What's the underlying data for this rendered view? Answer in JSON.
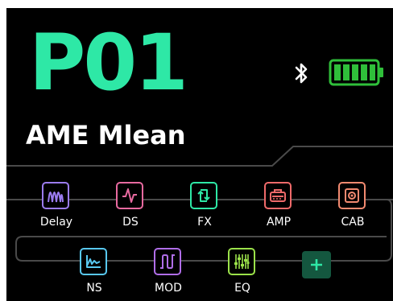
{
  "preset": {
    "number": "P01",
    "name": "AME Mlean"
  },
  "status": {
    "bluetooth_icon": "bluetooth-icon",
    "battery_icon": "battery-icon",
    "battery_level": 1.0,
    "battery_color": "#2fbf3a"
  },
  "chain_row_1": [
    {
      "label": "Delay",
      "icon": "delay-wave-icon",
      "color": "#9b7cf0"
    },
    {
      "label": "DS",
      "icon": "distortion-icon",
      "color": "#e86aa0"
    },
    {
      "label": "FX",
      "icon": "loop-arrows-icon",
      "color": "#2ee8a6"
    },
    {
      "label": "AMP",
      "icon": "amp-icon",
      "color": "#ef6a6a"
    },
    {
      "label": "CAB",
      "icon": "cabinet-icon",
      "color": "#f28a70"
    }
  ],
  "chain_row_2": [
    {
      "label": "NS",
      "icon": "noise-gate-icon",
      "color": "#58c8f0"
    },
    {
      "label": "MOD",
      "icon": "modulation-icon",
      "color": "#b06ee8"
    },
    {
      "label": "EQ",
      "icon": "eq-sliders-icon",
      "color": "#9be24a"
    }
  ],
  "add_button": {
    "label": "+",
    "icon": "plus-icon",
    "color": "#2ee8a6"
  },
  "accent": "#2ee8a6"
}
